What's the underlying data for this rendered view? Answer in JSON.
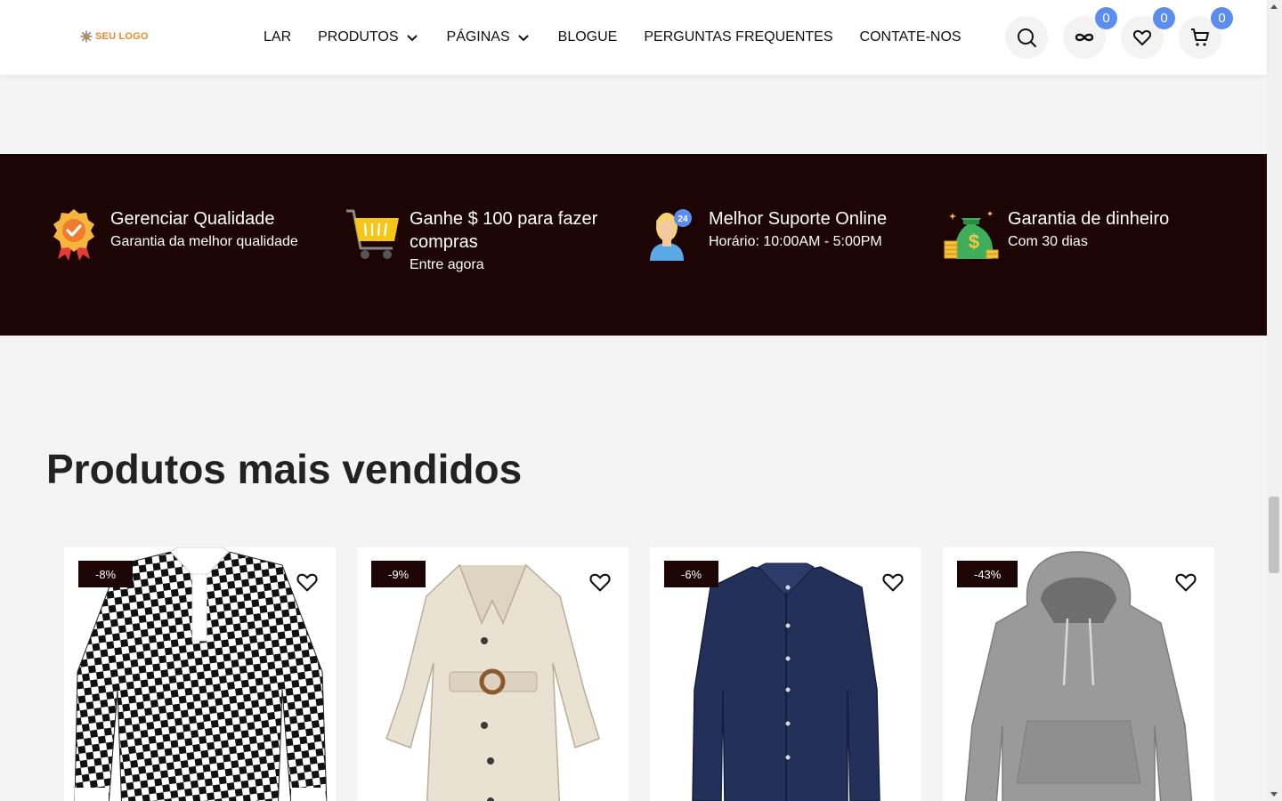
{
  "header": {
    "logo_text": "SEU LOGO",
    "nav": [
      {
        "label": "LAR",
        "dropdown": false
      },
      {
        "label": "PRODUTOS",
        "dropdown": true
      },
      {
        "label": "PÁGINAS",
        "dropdown": true
      },
      {
        "label": "BLOGUE",
        "dropdown": false
      },
      {
        "label": "PERGUNTAS FREQUENTES",
        "dropdown": false
      },
      {
        "label": "CONTATE-NOS",
        "dropdown": false
      }
    ],
    "icons": [
      {
        "name": "search-icon",
        "badge": null
      },
      {
        "name": "compare-icon",
        "badge": "0"
      },
      {
        "name": "heart-icon",
        "badge": "0"
      },
      {
        "name": "cart-icon",
        "badge": "0"
      }
    ],
    "badge_color": "#5b8def"
  },
  "features": [
    {
      "icon": "quality-badge-icon",
      "title": "Gerenciar Qualidade",
      "subtitle": "Garantia da melhor qualidade"
    },
    {
      "icon": "shopping-cart-icon",
      "title": "Ganhe $ 100 para fazer compras",
      "subtitle": "Entre agora"
    },
    {
      "icon": "support-agent-icon",
      "title": "Melhor Suporte Online",
      "subtitle": "Horário: 10:00AM - 5:00PM"
    },
    {
      "icon": "money-bag-icon",
      "title": "Garantia de dinheiro",
      "subtitle": "Com 30 dias"
    }
  ],
  "features_bg": "#1e0505",
  "section": {
    "title": "Produtos mais vendidos"
  },
  "products": [
    {
      "discount": "-8%",
      "image": "checkered-polo-shirt"
    },
    {
      "discount": "-9%",
      "image": "beige-trench-coat"
    },
    {
      "discount": "-6%",
      "image": "navy-dress-shirt"
    },
    {
      "discount": "-43%",
      "image": "gray-hoodie"
    }
  ]
}
